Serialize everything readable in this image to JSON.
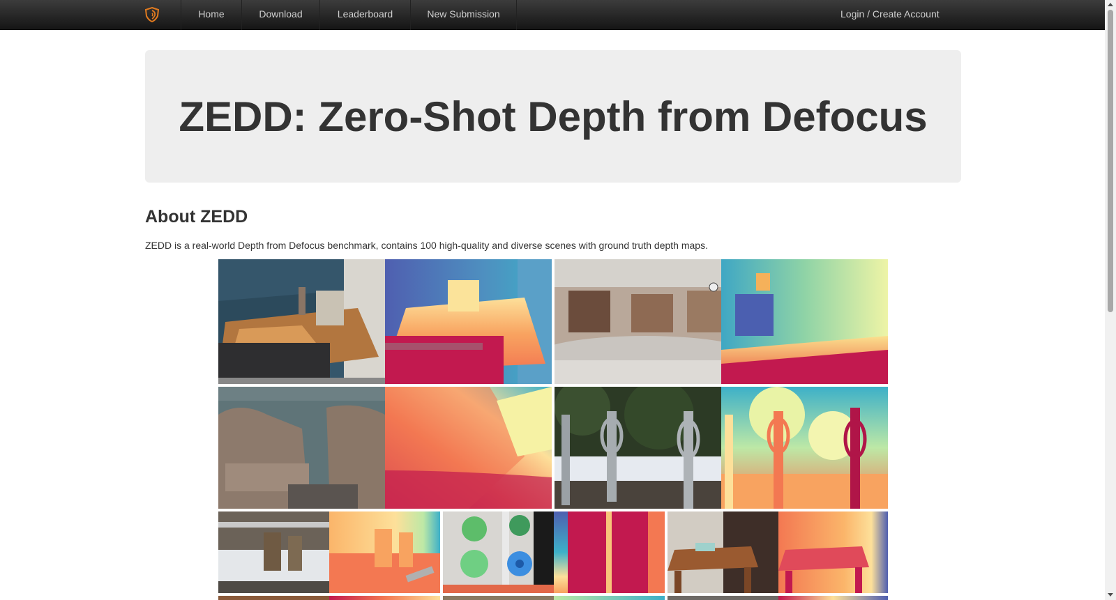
{
  "navbar": {
    "brand_icon": "shield-logo-icon",
    "items": [
      {
        "label": "Home"
      },
      {
        "label": "Download"
      },
      {
        "label": "Leaderboard"
      },
      {
        "label": "New Submission"
      }
    ],
    "login_label": "Login / Create Account",
    "brand_color": "#e07a1f"
  },
  "jumbotron": {
    "title": "ZEDD: Zero-Shot Depth from Defocus"
  },
  "about": {
    "heading": "About ZEDD",
    "text": "ZEDD is a real-world Depth from Defocus benchmark, contains 100 high-quality and diverse scenes with ground truth depth maps."
  },
  "gallery": [
    {
      "scene": "table-with-books-photo",
      "type": "rgb"
    },
    {
      "scene": "table-with-books-depth",
      "type": "depth"
    },
    {
      "scene": "lecture-hall-photo",
      "type": "rgb"
    },
    {
      "scene": "lecture-hall-depth",
      "type": "depth"
    },
    {
      "scene": "armchairs-photo",
      "type": "rgb"
    },
    {
      "scene": "armchairs-depth",
      "type": "depth"
    },
    {
      "scene": "bike-racks-snow-photo",
      "type": "rgb"
    },
    {
      "scene": "bike-racks-snow-depth",
      "type": "depth"
    },
    {
      "scene": "wood-stumps-snow-photo",
      "type": "rgb"
    },
    {
      "scene": "wood-stumps-snow-depth",
      "type": "depth"
    },
    {
      "scene": "green-blue-toys-photo",
      "type": "rgb"
    },
    {
      "scene": "green-blue-toys-depth",
      "type": "depth"
    },
    {
      "scene": "side-table-tissue-photo",
      "type": "rgb"
    },
    {
      "scene": "side-table-tissue-depth",
      "type": "depth"
    }
  ]
}
